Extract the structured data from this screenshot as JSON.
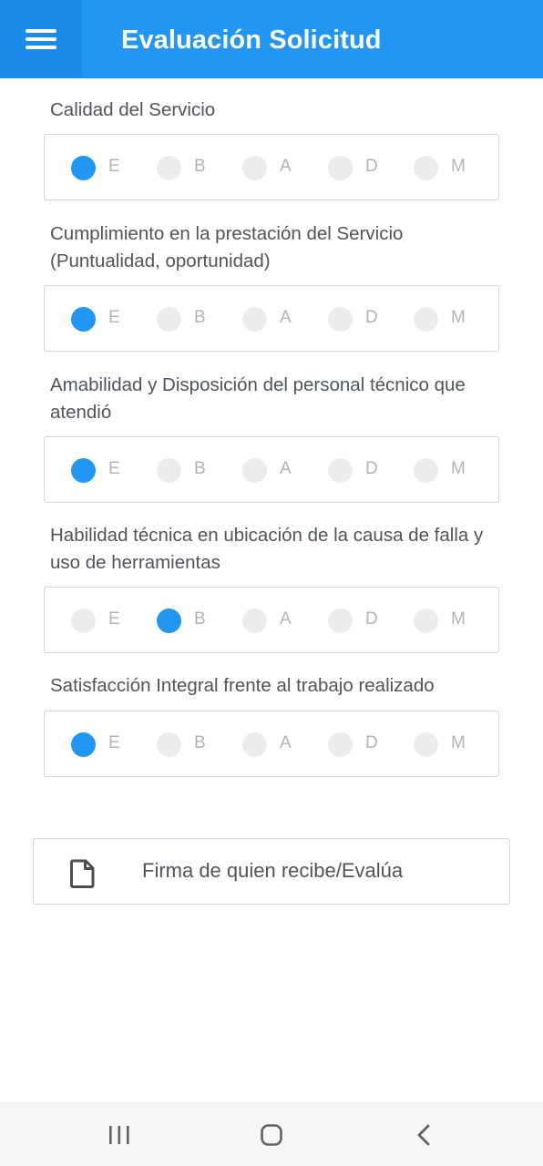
{
  "header": {
    "title": "Evaluación Solicitud",
    "menu_icon": "hamburger-menu-icon"
  },
  "options": [
    "E",
    "B",
    "A",
    "D",
    "M"
  ],
  "questions": [
    {
      "label": "Calidad del Servicio",
      "selected": "E"
    },
    {
      "label": "Cumplimiento en la prestación del Servicio (Puntualidad, oportunidad)",
      "selected": "E"
    },
    {
      "label": "Amabilidad y Disposición del personal técnico que atendió",
      "selected": "E"
    },
    {
      "label": "Habilidad técnica en ubicación de la causa de falla y uso de herramientas",
      "selected": "B"
    },
    {
      "label": "Satisfacción Integral frente al trabajo realizado",
      "selected": "E"
    }
  ],
  "signature": {
    "label": "Firma de quien recibe/Evalúa",
    "icon": "document-icon"
  },
  "system_nav": {
    "recent_icon": "recent-apps-icon",
    "home_icon": "home-icon",
    "back_icon": "back-icon"
  },
  "colors": {
    "primary": "#2196f3",
    "primary_dark": "#1c8ae8",
    "radio_unchecked": "#ececec",
    "text": "#4f555d",
    "option_letter": "#b4b4b4"
  }
}
